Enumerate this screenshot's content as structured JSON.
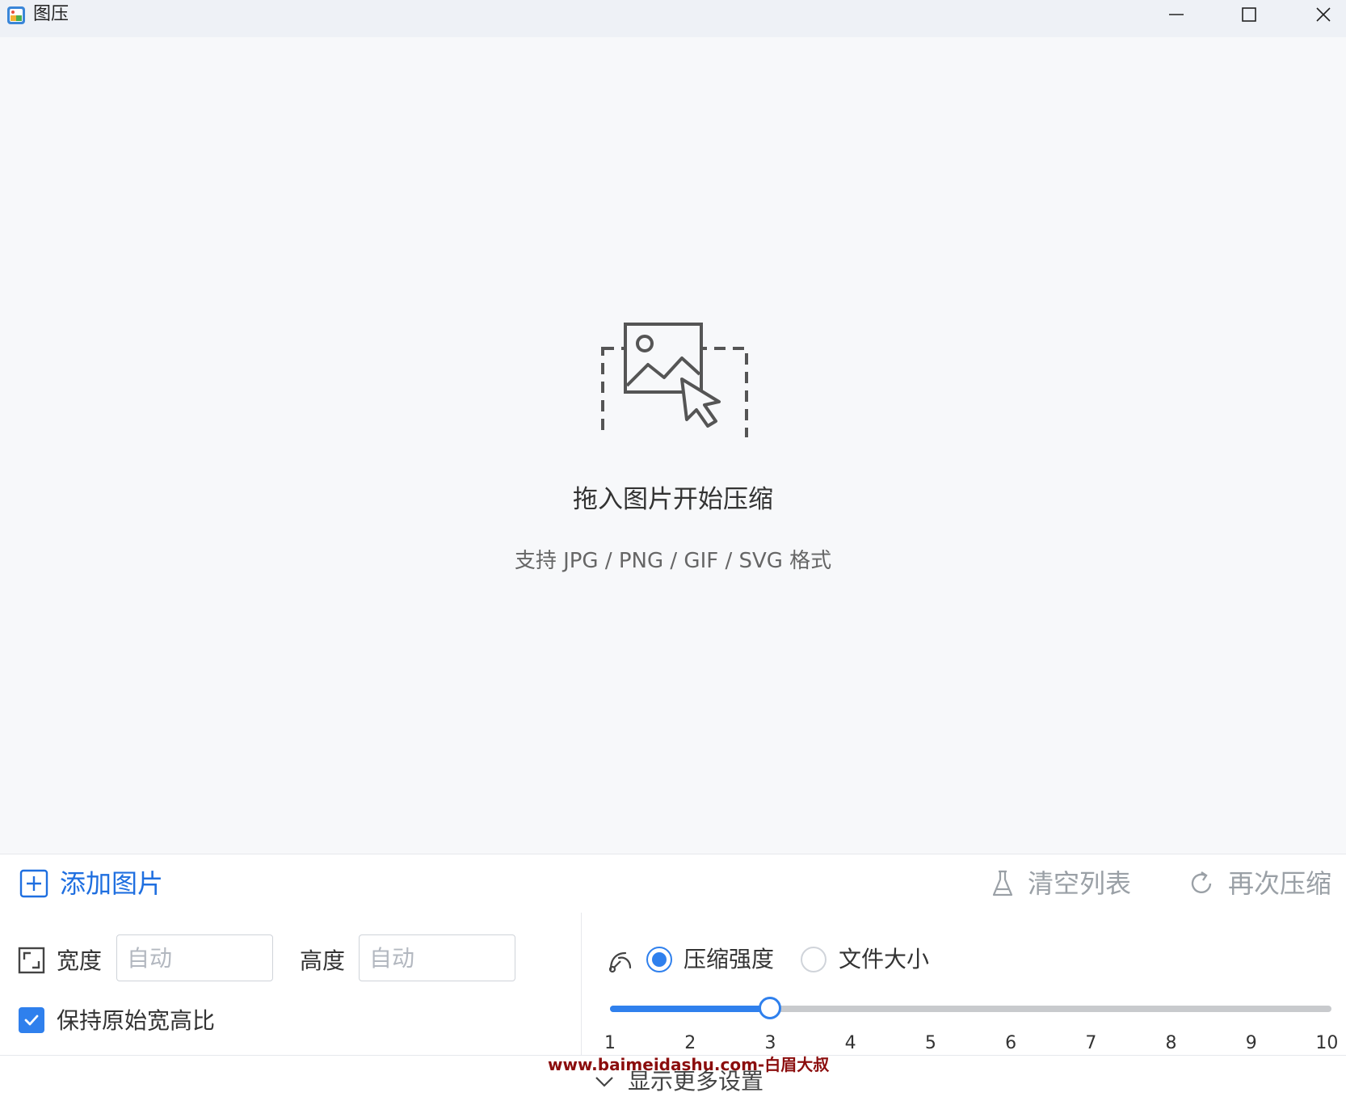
{
  "window": {
    "title": "图压"
  },
  "dropzone": {
    "title": "拖入图片开始压缩",
    "subtitle": "支持 JPG / PNG / GIF / SVG 格式"
  },
  "actions": {
    "add_label": "添加图片",
    "clear_label": "清空列表",
    "recompress_label": "再次压缩"
  },
  "resize": {
    "width_label": "宽度",
    "width_placeholder": "自动",
    "height_label": "高度",
    "height_placeholder": "自动",
    "keep_ratio_label": "保持原始宽高比",
    "keep_ratio_checked": true
  },
  "compression": {
    "mode_strength_label": "压缩强度",
    "mode_size_label": "文件大小",
    "selected_mode": "strength",
    "slider": {
      "min": 1,
      "max": 10,
      "value": 3,
      "ticks": [
        "1",
        "2",
        "3",
        "4",
        "5",
        "6",
        "7",
        "8",
        "9",
        "10"
      ]
    }
  },
  "footer": {
    "more_label": "显示更多设置",
    "watermark": "www.baimeidashu.com-白眉大叔"
  },
  "colors": {
    "accent": "#2f80ed",
    "link": "#1f6fe0",
    "muted": "#9aa0a6",
    "watermark": "#8b0d0d"
  }
}
